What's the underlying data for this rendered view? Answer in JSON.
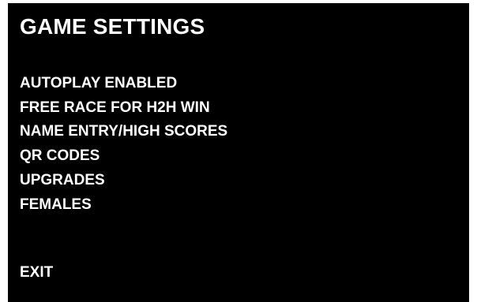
{
  "title": "GAME SETTINGS",
  "menu": {
    "items": [
      {
        "label": "AUTOPLAY ENABLED"
      },
      {
        "label": "FREE RACE FOR H2H WIN"
      },
      {
        "label": "NAME ENTRY/HIGH SCORES"
      },
      {
        "label": "QR CODES"
      },
      {
        "label": "UPGRADES"
      },
      {
        "label": "FEMALES"
      }
    ],
    "exit_label": "EXIT"
  },
  "colors": {
    "background": "#000000",
    "text": "#ffffff",
    "frame": "#ffffff"
  }
}
